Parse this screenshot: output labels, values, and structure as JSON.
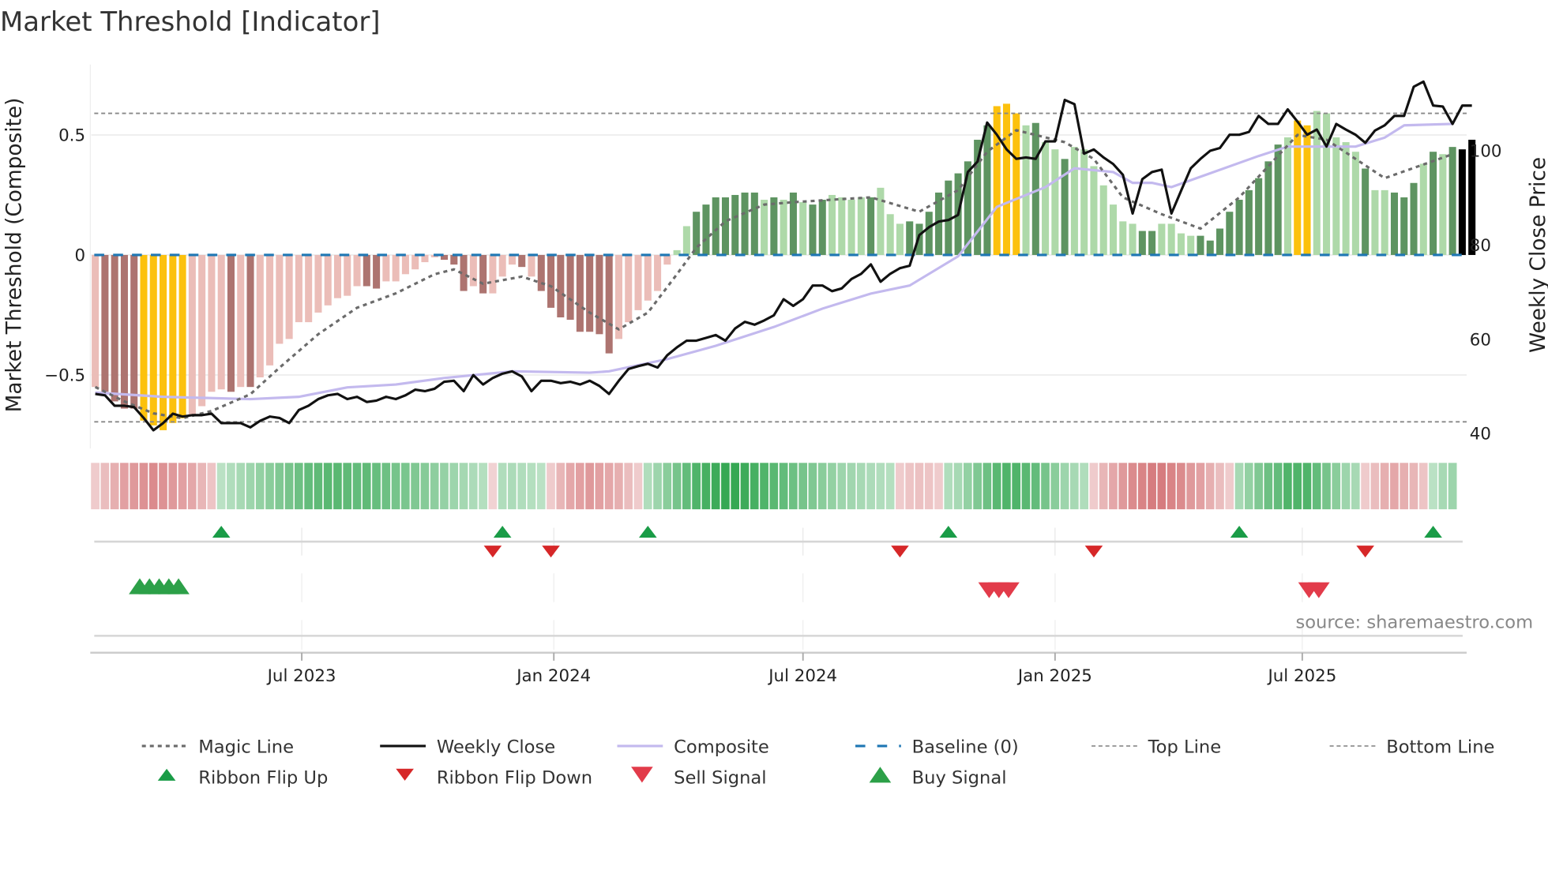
{
  "chart_data": {
    "type": "bar",
    "title": "Market Threshold [Indicator]",
    "ylabel": "Market Threshold (Composite)",
    "ylabel_right": "Weekly Close Price",
    "ylim": [
      -0.78,
      0.8
    ],
    "ylim_right": [
      40,
      115
    ],
    "yticks": [
      {
        "value": 0.5,
        "label": "0.5"
      },
      {
        "value": 0,
        "label": "0"
      },
      {
        "value": -0.5,
        "label": "−0.5"
      }
    ],
    "yticks_right": [
      {
        "value": 100,
        "label": "100"
      },
      {
        "value": 80,
        "label": "80"
      },
      {
        "value": 60,
        "label": "60"
      },
      {
        "value": 40,
        "label": "40"
      }
    ],
    "x_unit": "week index (weekly bars, ~Feb 2023 to Oct 2025)",
    "xticks": [
      {
        "index": 21.3,
        "label": "Jul 2023"
      },
      {
        "index": 47.3,
        "label": "Jan 2024"
      },
      {
        "index": 73.0,
        "label": "Jul 2024"
      },
      {
        "index": 99.0,
        "label": "Jan 2025"
      },
      {
        "index": 124.5,
        "label": "Jul 2025"
      }
    ],
    "top_line": 0.59,
    "bottom_line": -0.695,
    "baseline": 0,
    "composite_bars": [
      -0.55,
      -0.57,
      -0.61,
      -0.64,
      -0.64,
      -0.69,
      -0.71,
      -0.73,
      -0.7,
      -0.68,
      -0.67,
      -0.63,
      -0.57,
      -0.56,
      -0.57,
      -0.55,
      -0.55,
      -0.51,
      -0.46,
      -0.37,
      -0.35,
      -0.28,
      -0.28,
      -0.24,
      -0.21,
      -0.18,
      -0.17,
      -0.13,
      -0.13,
      -0.14,
      -0.11,
      -0.11,
      -0.08,
      -0.06,
      -0.03,
      -0.01,
      -0.02,
      -0.04,
      -0.15,
      -0.13,
      -0.16,
      -0.16,
      -0.09,
      -0.04,
      -0.05,
      -0.09,
      -0.15,
      -0.22,
      -0.26,
      -0.27,
      -0.32,
      -0.32,
      -0.33,
      -0.41,
      -0.35,
      -0.28,
      -0.23,
      -0.19,
      -0.15,
      -0.04,
      0.02,
      0.12,
      0.18,
      0.21,
      0.24,
      0.24,
      0.25,
      0.26,
      0.26,
      0.23,
      0.24,
      0.23,
      0.26,
      0.22,
      0.21,
      0.23,
      0.25,
      0.24,
      0.23,
      0.24,
      0.24,
      0.28,
      0.17,
      0.13,
      0.14,
      0.13,
      0.18,
      0.26,
      0.31,
      0.34,
      0.39,
      0.48,
      0.54,
      0.62,
      0.63,
      0.59,
      0.54,
      0.55,
      0.47,
      0.44,
      0.4,
      0.45,
      0.44,
      0.37,
      0.29,
      0.21,
      0.14,
      0.13,
      0.1,
      0.1,
      0.13,
      0.13,
      0.09,
      0.08,
      0.08,
      0.06,
      0.11,
      0.18,
      0.23,
      0.27,
      0.32,
      0.39,
      0.46,
      0.49,
      0.56,
      0.54,
      0.6,
      0.59,
      0.49,
      0.47,
      0.43,
      0.36,
      0.27,
      0.27,
      0.26,
      0.24,
      0.3,
      0.38,
      0.43,
      0.42,
      0.45,
      0.44,
      0.48
    ],
    "bar_states": "rRRRRYYYYYrrrrRrRrrrrrrrrrrrRRrrrrrrRRRrRrrrRrRRRRRRRRrrrrrrggGGGGGGGgGgGgGGggggGgggGGGGGGGGGYYYgGggGgggggggGGggggGGGGGGGGGgYYgggggGggGGGgGgG",
    "bar_state_legend": {
      "R": "negative strong",
      "r": "negative weak",
      "G": "positive strong",
      "g": "positive weak",
      "Y": "signal week"
    },
    "weekly_close": [
      48.4,
      48.1,
      45.9,
      45.9,
      45.6,
      43.3,
      40.7,
      42.2,
      44.2,
      43.6,
      43.9,
      43.9,
      44.2,
      42.2,
      42.2,
      42.2,
      41.3,
      42.7,
      43.6,
      43.3,
      42.2,
      45.0,
      45.9,
      47.3,
      48.1,
      48.4,
      47.3,
      47.8,
      46.7,
      47.0,
      47.8,
      47.3,
      48.1,
      49.3,
      49.0,
      49.5,
      51.0,
      51.2,
      49.0,
      52.4,
      50.4,
      51.8,
      52.7,
      53.2,
      52.1,
      49.0,
      51.2,
      51.2,
      50.7,
      51.0,
      50.4,
      51.2,
      50.1,
      48.4,
      51.2,
      53.7,
      54.3,
      54.8,
      54.0,
      56.6,
      58.3,
      59.7,
      59.7,
      60.3,
      60.9,
      59.7,
      62.3,
      63.7,
      63.1,
      64.0,
      65.1,
      68.5,
      67.1,
      68.5,
      71.4,
      71.4,
      70.2,
      70.8,
      72.8,
      73.9,
      75.9,
      72.2,
      73.9,
      75.1,
      75.6,
      82.1,
      83.8,
      85.0,
      85.3,
      86.4,
      95.5,
      97.7,
      106.0,
      103.4,
      100.3,
      98.3,
      98.6,
      98.3,
      102.0,
      102.0,
      110.8,
      109.9,
      99.4,
      100.3,
      98.6,
      97.2,
      94.9,
      86.7,
      94.0,
      95.5,
      96.0,
      86.7,
      91.5,
      96.3,
      98.3,
      100.0,
      100.6,
      103.4,
      103.4,
      104.0,
      107.4,
      105.7,
      105.7,
      108.8,
      106.2,
      103.4,
      104.5,
      100.9,
      105.7,
      104.5,
      103.4,
      101.7,
      104.3,
      105.4,
      107.4,
      107.4,
      113.6,
      114.7,
      109.6,
      109.4,
      105.7,
      109.6,
      109.6
    ],
    "magic_line": [
      [
        0,
        -0.55
      ],
      [
        3,
        -0.61
      ],
      [
        6,
        -0.66
      ],
      [
        9,
        -0.68
      ],
      [
        12,
        -0.65
      ],
      [
        16,
        -0.58
      ],
      [
        19,
        -0.47
      ],
      [
        23,
        -0.33
      ],
      [
        27,
        -0.22
      ],
      [
        31,
        -0.16
      ],
      [
        35,
        -0.08
      ],
      [
        37,
        -0.06
      ],
      [
        40,
        -0.12
      ],
      [
        44,
        -0.09
      ],
      [
        47,
        -0.13
      ],
      [
        51,
        -0.24
      ],
      [
        54,
        -0.31
      ],
      [
        57,
        -0.24
      ],
      [
        60,
        -0.08
      ],
      [
        62,
        0.03
      ],
      [
        65,
        0.14
      ],
      [
        69,
        0.21
      ],
      [
        72,
        0.22
      ],
      [
        76,
        0.23
      ],
      [
        80,
        0.24
      ],
      [
        85,
        0.18
      ],
      [
        89,
        0.27
      ],
      [
        92,
        0.43
      ],
      [
        95,
        0.52
      ],
      [
        100,
        0.47
      ],
      [
        103,
        0.4
      ],
      [
        106,
        0.24
      ],
      [
        110,
        0.17
      ],
      [
        114,
        0.11
      ],
      [
        118,
        0.24
      ],
      [
        124,
        0.5
      ],
      [
        127,
        0.48
      ],
      [
        130,
        0.4
      ],
      [
        133,
        0.32
      ],
      [
        140,
        0.42
      ]
    ],
    "composite_line": [
      [
        0,
        48.7
      ],
      [
        7,
        47.8
      ],
      [
        16,
        47.3
      ],
      [
        21,
        47.8
      ],
      [
        26,
        49.8
      ],
      [
        31,
        50.4
      ],
      [
        36,
        51.8
      ],
      [
        43,
        53.2
      ],
      [
        51,
        52.9
      ],
      [
        53,
        53.2
      ],
      [
        59,
        55.8
      ],
      [
        64,
        58.6
      ],
      [
        70,
        62.6
      ],
      [
        75,
        66.5
      ],
      [
        80,
        69.7
      ],
      [
        84,
        71.4
      ],
      [
        89,
        77.6
      ],
      [
        93,
        88.1
      ],
      [
        98,
        92.3
      ],
      [
        101,
        96.3
      ],
      [
        105,
        95.5
      ],
      [
        107,
        93.2
      ],
      [
        109,
        93.2
      ],
      [
        111,
        92.3
      ],
      [
        120,
        98.9
      ],
      [
        123,
        100.9
      ],
      [
        130,
        100.9
      ],
      [
        133,
        102.8
      ],
      [
        135,
        105.4
      ],
      [
        140,
        105.7
      ]
    ],
    "ribbon": [
      -0.15,
      -0.25,
      -0.35,
      -0.45,
      -0.5,
      -0.55,
      -0.6,
      -0.55,
      -0.5,
      -0.45,
      -0.4,
      -0.3,
      -0.2,
      0.15,
      0.2,
      0.25,
      0.3,
      0.35,
      0.4,
      0.45,
      0.5,
      0.55,
      0.6,
      0.62,
      0.65,
      0.65,
      0.62,
      0.6,
      0.62,
      0.58,
      0.55,
      0.5,
      0.48,
      0.45,
      0.42,
      0.38,
      0.34,
      0.3,
      0.26,
      0.22,
      0.18,
      -0.1,
      0.2,
      0.22,
      0.2,
      0.18,
      0.15,
      -0.15,
      -0.3,
      -0.4,
      -0.45,
      -0.5,
      -0.45,
      -0.4,
      -0.35,
      -0.25,
      -0.15,
      0.2,
      0.3,
      0.4,
      0.5,
      0.6,
      0.7,
      0.75,
      0.8,
      0.85,
      0.85,
      0.8,
      0.75,
      0.7,
      0.65,
      0.6,
      0.55,
      0.5,
      0.45,
      0.4,
      0.35,
      0.3,
      0.28,
      0.25,
      0.22,
      0.2,
      0.18,
      -0.15,
      -0.2,
      -0.22,
      -0.2,
      -0.15,
      0.2,
      0.25,
      0.35,
      0.45,
      0.55,
      0.65,
      0.7,
      0.7,
      0.65,
      0.6,
      0.5,
      0.4,
      0.3,
      0.25,
      0.2,
      -0.15,
      -0.3,
      -0.4,
      -0.5,
      -0.6,
      -0.65,
      -0.7,
      -0.7,
      -0.65,
      -0.6,
      -0.5,
      -0.45,
      -0.35,
      -0.25,
      -0.15,
      0.25,
      0.35,
      0.45,
      0.55,
      0.6,
      0.7,
      0.7,
      0.7,
      0.6,
      0.5,
      0.4,
      0.3,
      0.25,
      -0.15,
      -0.25,
      -0.35,
      -0.4,
      -0.35,
      -0.3,
      -0.2,
      0.15,
      0.25,
      0.3
    ],
    "ribbon_flip_up": [
      13,
      42,
      57,
      88,
      118,
      138
    ],
    "ribbon_flip_down": [
      41,
      47,
      83,
      103,
      131
    ],
    "buy_signals": [
      5,
      6,
      7,
      8,
      9
    ],
    "sell_signals": [
      92,
      93,
      94,
      125,
      126
    ],
    "source": "source: sharemaestro.com",
    "legend": [
      {
        "label": "Magic Line",
        "kind": "dotted",
        "color": "#6b6b6b"
      },
      {
        "label": "Weekly Close",
        "kind": "line",
        "color": "#111111"
      },
      {
        "label": "Composite",
        "kind": "line",
        "color": "#c3b9ee"
      },
      {
        "label": "Baseline (0)",
        "kind": "dashed",
        "color": "#1f77b4"
      },
      {
        "label": "Top Line",
        "kind": "thin-dashed",
        "color": "#888888"
      },
      {
        "label": "Bottom Line",
        "kind": "thin-dashed",
        "color": "#888888"
      },
      {
        "label": "Ribbon Flip Up",
        "kind": "tri-up-small",
        "color": "#1a9c47"
      },
      {
        "label": "Ribbon Flip Down",
        "kind": "tri-down-small",
        "color": "#d62728"
      },
      {
        "label": "Sell Signal",
        "kind": "tri-down",
        "color": "#e23b4a"
      },
      {
        "label": "Buy Signal",
        "kind": "tri-up",
        "color": "#2ca048"
      }
    ],
    "colors": {
      "R": "#ad7470",
      "r": "#ebbdb8",
      "G": "#5e9461",
      "g": "#aed9a9",
      "Y": "#fcc10d",
      "ribbon_pos": "#35a853",
      "ribbon_neg": "#d0686b"
    }
  }
}
